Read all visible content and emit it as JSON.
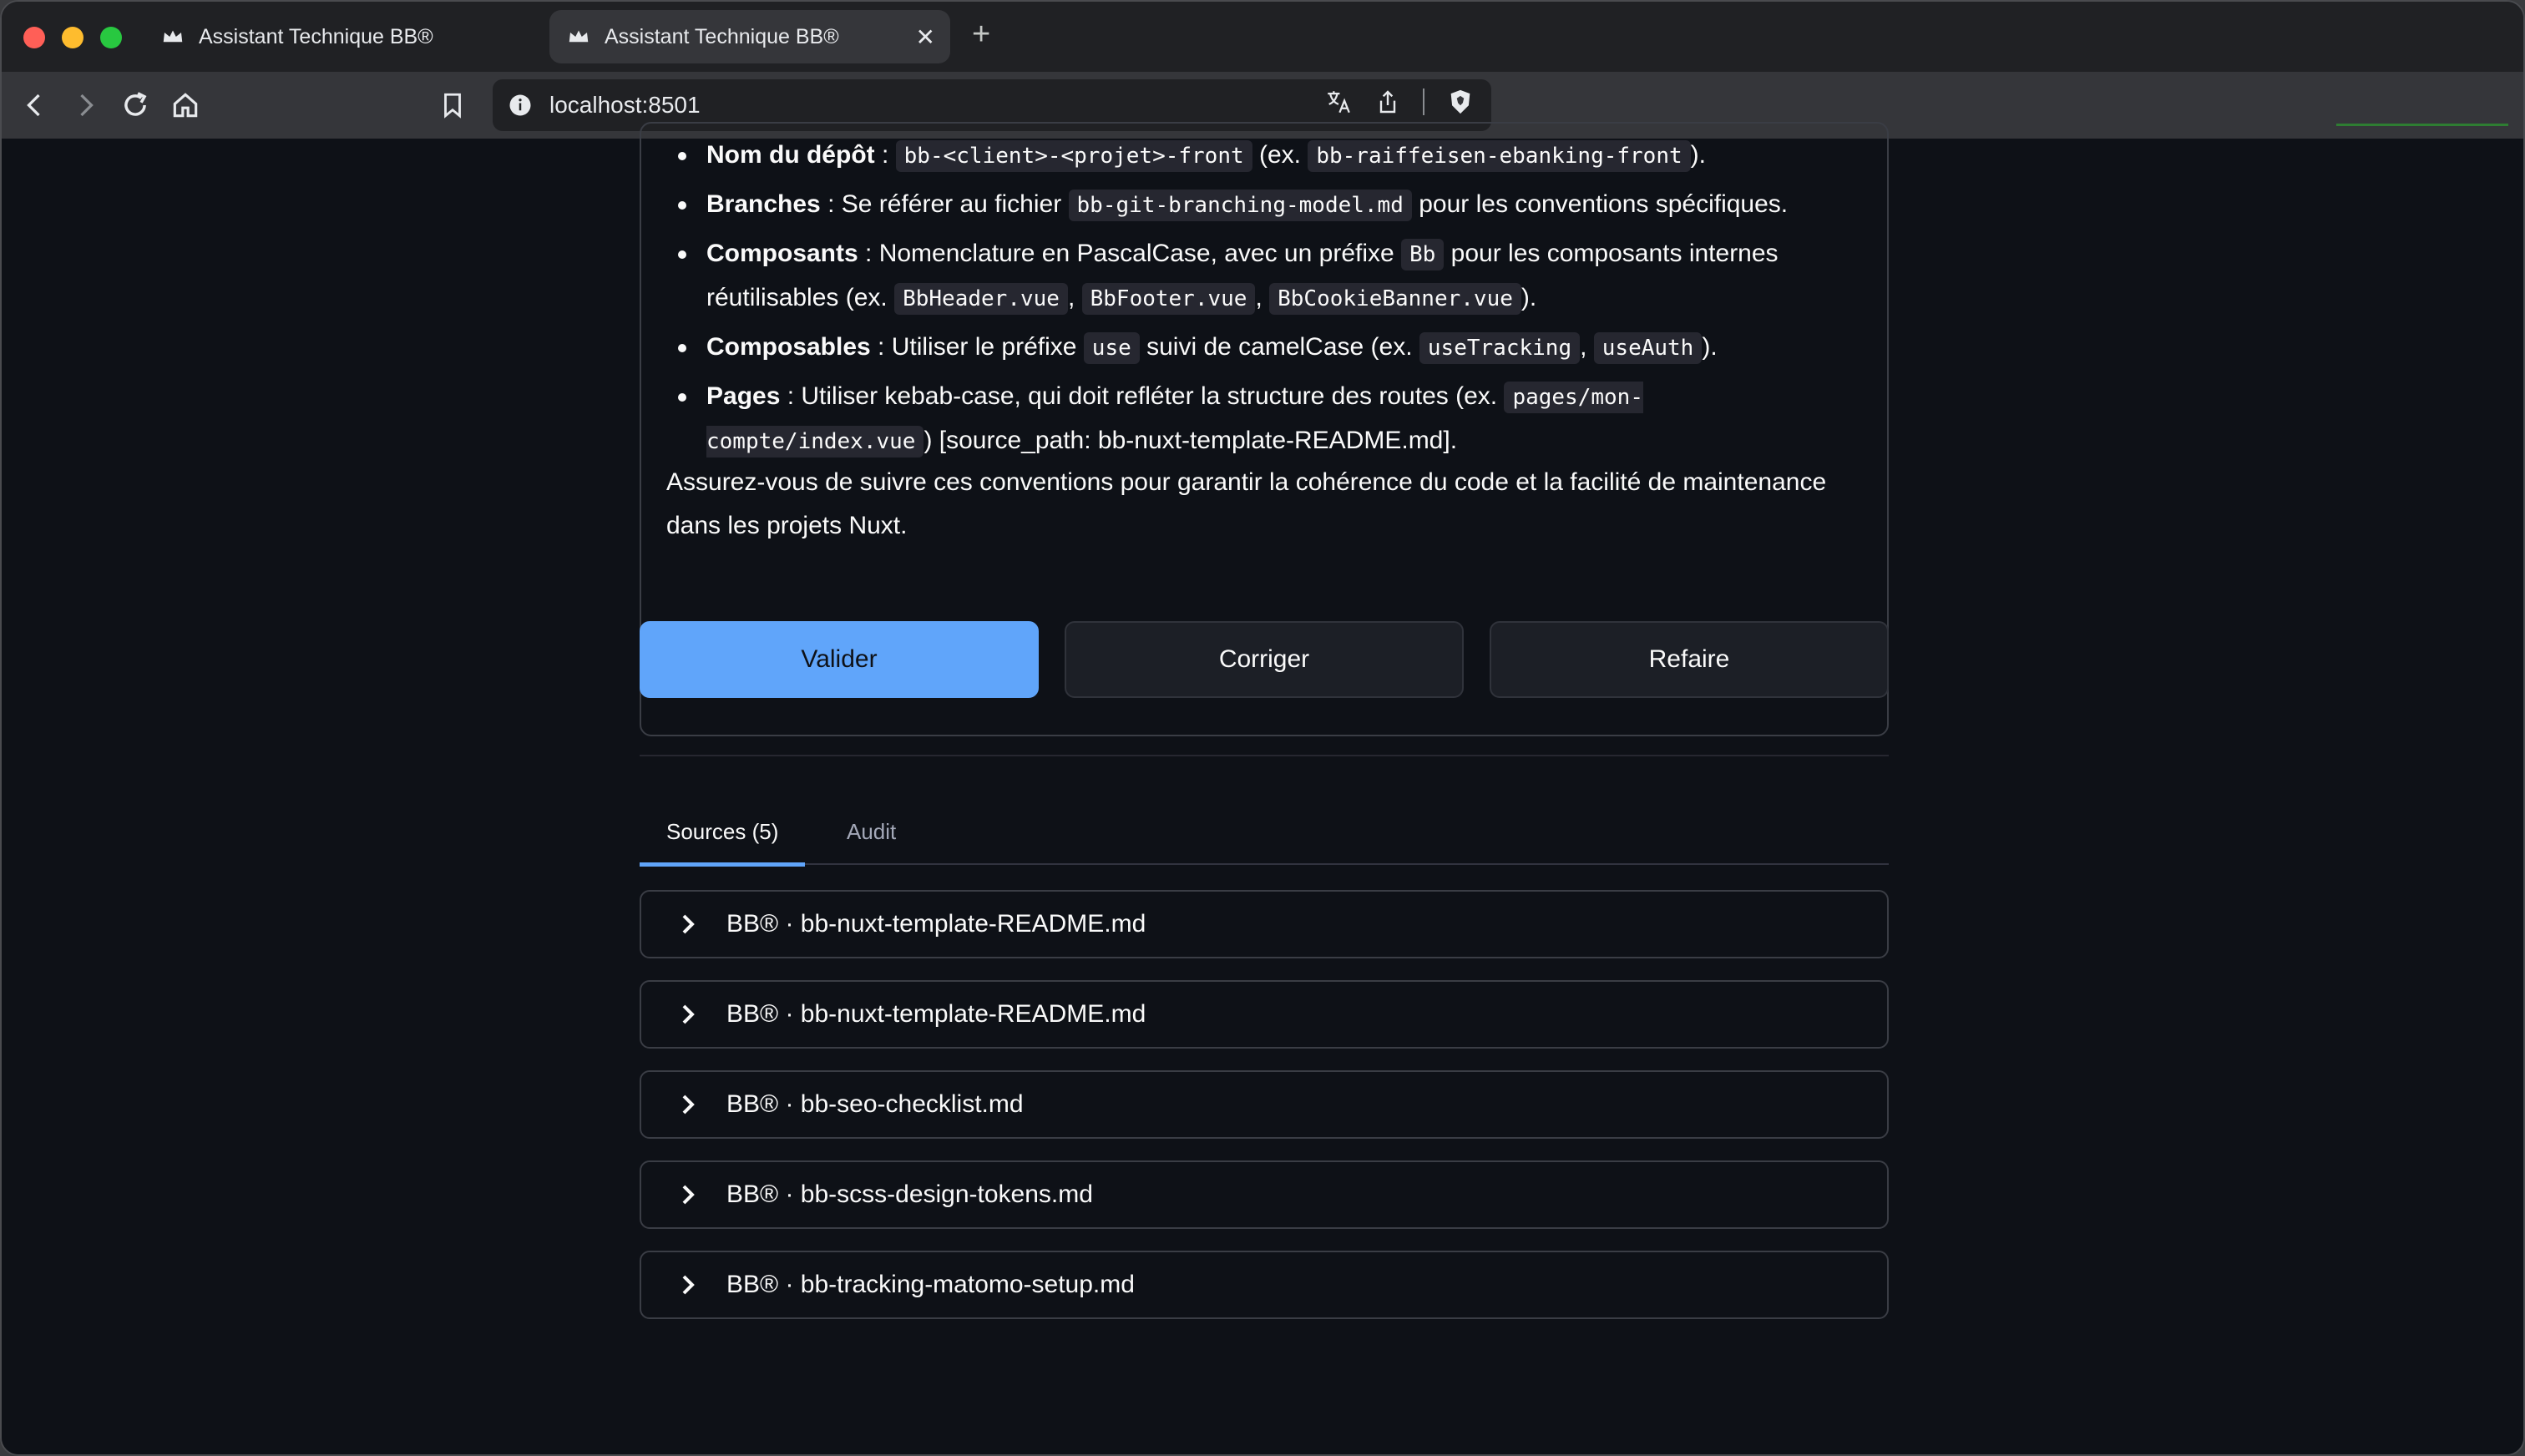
{
  "browser": {
    "tabs": [
      {
        "title": "Assistant Technique BB®",
        "active": false
      },
      {
        "title": "Assistant Technique BB®",
        "active": true
      }
    ],
    "new_tab_label": "+",
    "close_label": "✕",
    "url": "localhost:8501"
  },
  "answer": {
    "items": [
      {
        "label": "Nom du dépôt",
        "sep": " : ",
        "code1": "bb-<client>-<projet>-front",
        "mid": " (ex. ",
        "code2": "bb-raiffeisen-ebanking-front",
        "end": ")."
      },
      {
        "label": "Branches",
        "text1": " : Se référer au fichier ",
        "code1": "bb-git-branching-model.md",
        "text2": " pour les conventions spécifiques."
      },
      {
        "label": "Composants",
        "text1": " : Nomenclature en PascalCase, avec un préfixe ",
        "code1": "Bb",
        "text2": " pour les composants internes réutilisables (ex. ",
        "code2": "BbHeader.vue",
        "comma1": ", ",
        "code3": "BbFooter.vue",
        "comma2": ", ",
        "code4": "BbCookieBanner.vue",
        "end": ")."
      },
      {
        "label": "Composables",
        "text1": " : Utiliser le préfixe ",
        "code1": "use",
        "text2": " suivi de camelCase (ex. ",
        "code2": "useTracking",
        "comma1": ", ",
        "code3": "useAuth",
        "end": ")."
      },
      {
        "label": "Pages",
        "text1": " : Utiliser kebab-case, qui doit refléter la structure des routes (ex. ",
        "code1": "pages/mon-compte/index.vue",
        "end": ") [source_path: bb-nuxt-template-README.md]."
      }
    ],
    "conclusion": "Assurez-vous de suivre ces conventions pour garantir la cohérence du code et la facilité de maintenance dans les projets Nuxt."
  },
  "actions": {
    "validate": "Valider",
    "correct": "Corriger",
    "redo": "Refaire"
  },
  "result_tabs": [
    {
      "label": "Sources (5)",
      "selected": true
    },
    {
      "label": "Audit",
      "selected": false
    }
  ],
  "sources": [
    "BB® · bb-nuxt-template-README.md",
    "BB® · bb-nuxt-template-README.md",
    "BB® · bb-seo-checklist.md",
    "BB® · bb-scss-design-tokens.md",
    "BB® · bb-tracking-matomo-setup.md"
  ],
  "colors": {
    "page_bg": "#0e1117",
    "primary": "#60a5fa",
    "chrome_dark": "#202124",
    "chrome_toolbar": "#35363a"
  }
}
